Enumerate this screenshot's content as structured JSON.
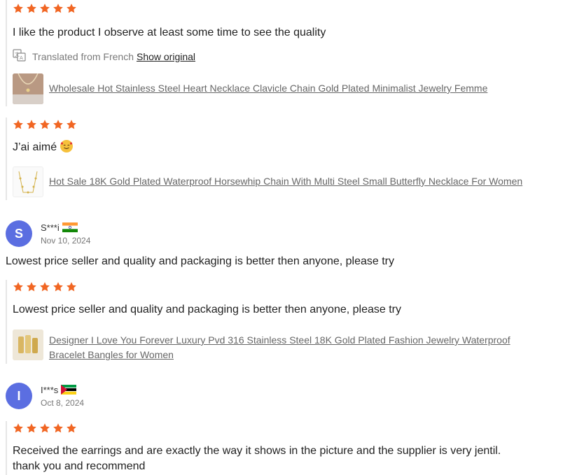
{
  "colors": {
    "star": "#f16623",
    "avatar": "#5b6ee1",
    "link": "#666666"
  },
  "reviews_top": [
    {
      "stars": 5,
      "text": "I like the product I observe at least some time to see the quality",
      "translated_label": "Translated from French",
      "show_original": "Show original",
      "product": "Wholesale Hot Stainless Steel Heart Necklace Clavicle Chain Gold Plated Minimalist Jewelry Femme"
    },
    {
      "stars": 5,
      "text": "J’ai aimé",
      "emoji": "smiling-face-with-hearts",
      "product": "Hot Sale 18K Gold Plated Waterproof Horsewhip Chain With Multi Steel Small Butterfly Necklace For Women"
    }
  ],
  "user_s": {
    "avatar_letter": "S",
    "name": "S***i",
    "flag": "india-flag",
    "date": "Nov 10, 2024",
    "headline": "Lowest price seller and quality and packaging is better then anyone, please try",
    "stars": 5,
    "text": "Lowest price seller and quality and packaging is better then anyone, please try",
    "product_line1": "Designer I Love You Forever Luxury Pvd 316 Stainless Steel 18K Gold Plated Fashion Jewelry Waterproof",
    "product_line2": "Bracelet Bangles for Women"
  },
  "user_i": {
    "avatar_letter": "I",
    "name": "I***s",
    "flag": "mozambique-flag",
    "date": "Oct 8, 2024",
    "stars": 5,
    "text_line1": "Received the earrings and are exactly the way it shows in the picture and the supplier is very jentil.",
    "text_line2": "thank you and recommend"
  }
}
